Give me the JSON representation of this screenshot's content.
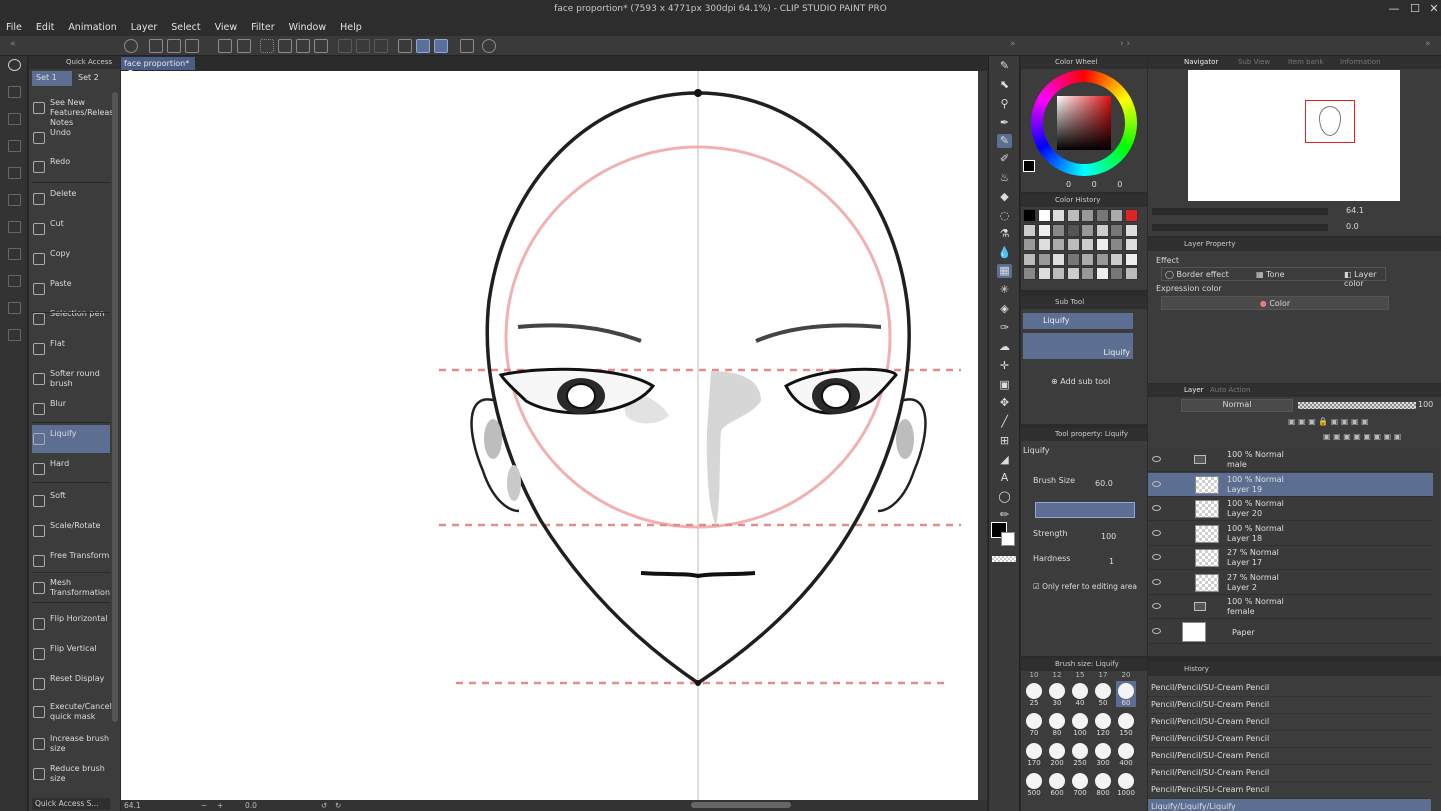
{
  "window": {
    "title": "face proportion* (7593 x 4771px 300dpi 64.1%) - CLIP STUDIO PAINT PRO",
    "minimize": "—",
    "maximize": "☐",
    "close": "✕"
  },
  "menu": [
    "File",
    "Edit",
    "Animation",
    "Layer",
    "Select",
    "View",
    "Filter",
    "Window",
    "Help"
  ],
  "quick_access": {
    "title": "Quick Access",
    "sets": [
      "Set 1",
      "Set 2"
    ],
    "items": [
      {
        "label": "See New Features/Release Notes",
        "icon": "new-icon"
      },
      {
        "label": "Undo",
        "icon": "undo-icon"
      },
      {
        "label": "Redo",
        "icon": "redo-icon"
      },
      {
        "label": "Delete",
        "icon": "delete-icon"
      },
      {
        "label": "Cut",
        "icon": "scissors-icon"
      },
      {
        "label": "Copy",
        "icon": "copy-icon"
      },
      {
        "label": "Paste",
        "icon": "paste-icon"
      },
      {
        "label": "Selection pen",
        "icon": "selection-pen-icon"
      },
      {
        "label": "Flat",
        "icon": "brush-icon"
      },
      {
        "label": "Softer round brush",
        "icon": "brush-icon"
      },
      {
        "label": "Blur",
        "icon": "blur-icon"
      },
      {
        "label": "Liquify",
        "icon": "liquify-icon"
      },
      {
        "label": "Hard",
        "icon": "eraser-icon"
      },
      {
        "label": "Soft",
        "icon": "eraser-icon"
      },
      {
        "label": "Scale/Rotate",
        "icon": "transform-icon"
      },
      {
        "label": "Free Transform",
        "icon": "transform-icon"
      },
      {
        "label": "Mesh Transformation",
        "icon": "mesh-icon"
      },
      {
        "label": "Flip Horizontal",
        "icon": "flip-h-icon"
      },
      {
        "label": "Flip Vertical",
        "icon": "flip-v-icon"
      },
      {
        "label": "Reset Display",
        "icon": "reset-icon"
      },
      {
        "label": "Execute/Cancel quick mask",
        "icon": "mask-icon"
      },
      {
        "label": "Increase brush size",
        "icon": "brush-plus-icon"
      },
      {
        "label": "Reduce brush size",
        "icon": "brush-minus-icon"
      }
    ],
    "footer": "Quick Access S..."
  },
  "document_tab": "face proportion*",
  "status": {
    "zoom": "64.1",
    "angle": "0.0"
  },
  "color_wheel": {
    "title": "Color Wheel",
    "values": [
      "0",
      "0",
      "0"
    ]
  },
  "color_history": {
    "title": "Color History"
  },
  "sub_tool": {
    "title": "Sub Tool",
    "active": "Liquify",
    "group_label": "Liquify",
    "add_button": "Add sub tool"
  },
  "tool_property": {
    "title": "Tool property: Liquify",
    "tool_name": "Liquify",
    "brush_size_label": "Brush Size",
    "brush_size": "60.0",
    "strength_label": "Strength",
    "strength": "100",
    "hardness_label": "Hardness",
    "hardness": "1",
    "refer_label": "Only refer to editing area"
  },
  "brush_size_panel": {
    "title": "Brush size: Liquify",
    "top_row": [
      "10",
      "12",
      "15",
      "17",
      "20"
    ],
    "sizes": [
      "25",
      "30",
      "40",
      "50",
      "60",
      "70",
      "80",
      "100",
      "120",
      "150",
      "170",
      "200",
      "250",
      "300",
      "400",
      "500",
      "600",
      "700",
      "800",
      "1000"
    ],
    "selected": "60"
  },
  "navigator": {
    "tabs": [
      "Navigator",
      "Sub View",
      "Item bank",
      "Information"
    ],
    "zoom": "64.1",
    "angle": "0.0"
  },
  "layer_property": {
    "title": "Layer Property",
    "effect_label": "Effect",
    "effects": [
      "Border effect",
      "Tone",
      "Layer color"
    ],
    "expression_label": "Expression color",
    "expression_value": "Color"
  },
  "layer_panel": {
    "tabs": [
      "Layer",
      "Auto Action"
    ],
    "blend_mode": "Normal",
    "opacity": "100",
    "layers": [
      {
        "line1": "100 % Normal",
        "line2": "male",
        "folder": true,
        "selected": false
      },
      {
        "line1": "100 % Normal",
        "line2": "Layer 19",
        "folder": false,
        "selected": true
      },
      {
        "line1": "100 % Normal",
        "line2": "Layer 20",
        "folder": false,
        "selected": false
      },
      {
        "line1": "100 % Normal",
        "line2": "Layer 18",
        "folder": false,
        "selected": false
      },
      {
        "line1": "27 % Normal",
        "line2": "Layer 17",
        "folder": false,
        "selected": false
      },
      {
        "line1": "27 % Normal",
        "line2": "Layer 2",
        "folder": false,
        "selected": false
      },
      {
        "line1": "100 % Normal",
        "line2": "female",
        "folder": true,
        "selected": false
      },
      {
        "line1": "",
        "line2": "Paper",
        "folder": false,
        "selected": false
      }
    ]
  },
  "history": {
    "title": "History",
    "entries": [
      "Pencil/Pencil/SU-Cream Pencil",
      "Pencil/Pencil/SU-Cream Pencil",
      "Pencil/Pencil/SU-Cream Pencil",
      "Pencil/Pencil/SU-Cream Pencil",
      "Pencil/Pencil/SU-Cream Pencil",
      "Pencil/Pencil/SU-Cream Pencil",
      "Pencil/Pencil/SU-Cream Pencil",
      "Liquify/Liquify/Liquify"
    ],
    "selected_index": 7
  },
  "colors": {
    "ui_bg": "#3c3c3c",
    "selection": "#5d6e93",
    "guide_red": "#e48b8b",
    "accent_red": "#e32222"
  }
}
